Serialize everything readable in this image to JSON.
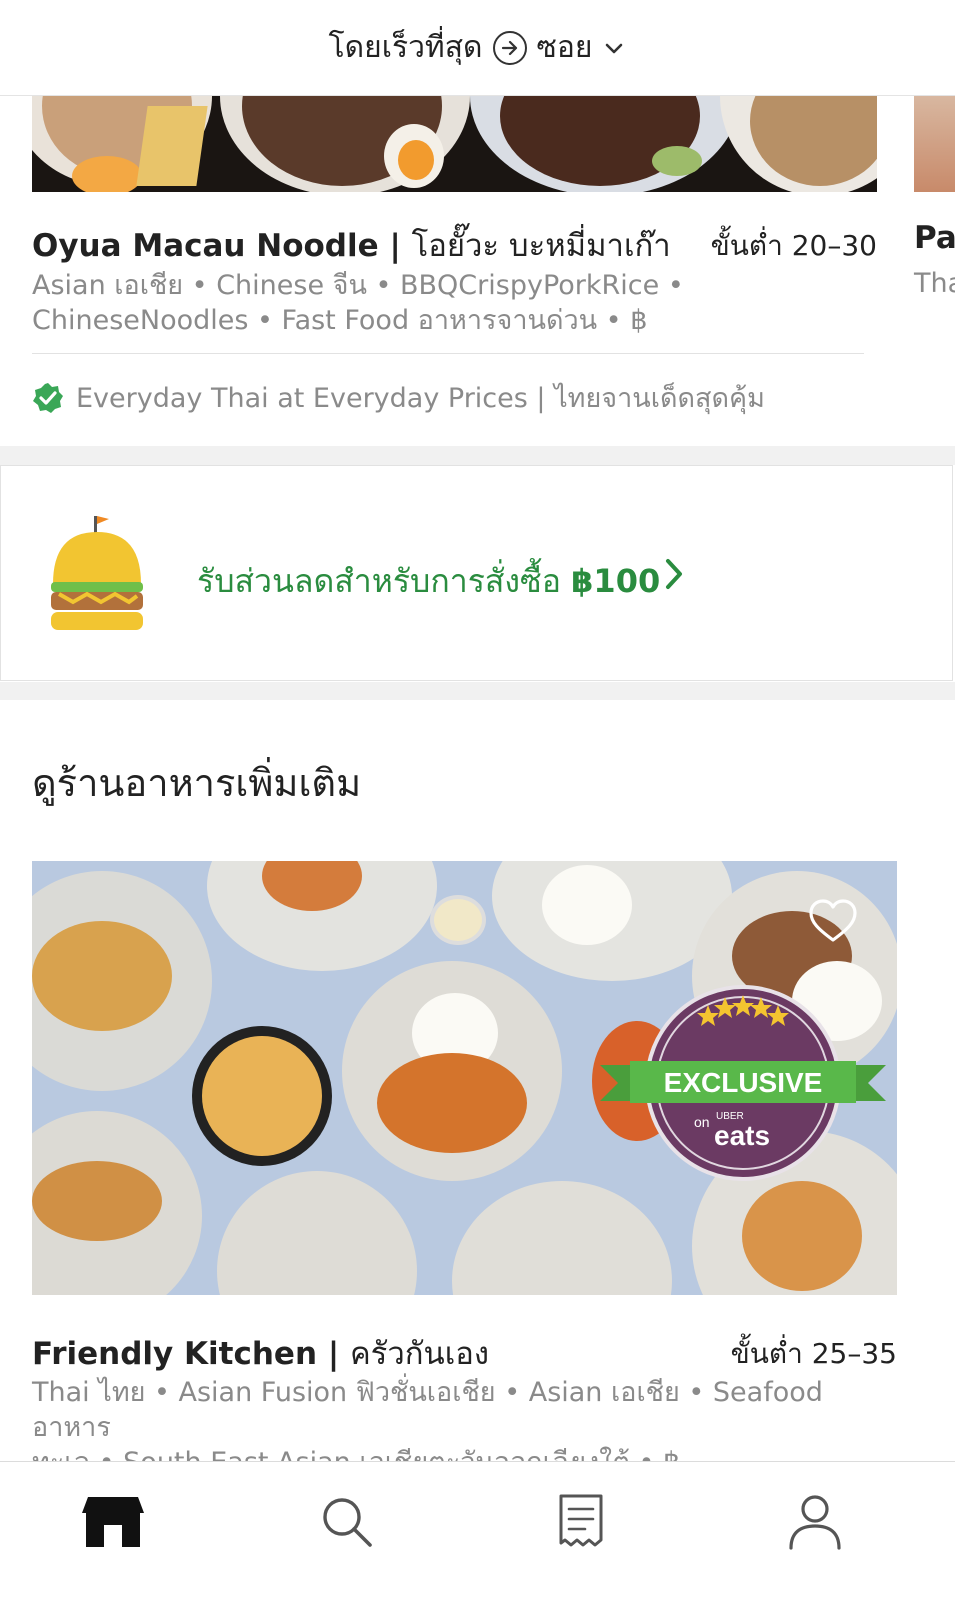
{
  "header": {
    "sort_label": "โดยเร็วที่สุด",
    "location": "ซอย"
  },
  "featured": {
    "name": "Oyua Macau Noodle |",
    "name_thai": "โอยั๊วะ บะหมี่มาเก๊า",
    "eta": "ขั้นต่ำ 20–30",
    "tags_line1": "Asian เอเชีย • Chinese จีน • BBQCrispyPorkRice •",
    "tags_line2": "ChineseNoodles • Fast Food อาหารจานด่วน • ฿",
    "promo": "Everyday Thai at Everyday Prices | ไทยจานเด็ดสุดคุ้ม"
  },
  "next_card": {
    "name": "Pa",
    "tag": "Tha"
  },
  "banner": {
    "text": "รับส่วนลดสำหรับการสั่งซื้อ",
    "amount": "฿100"
  },
  "more": {
    "title": "ดูร้านอาหารเพิ่มเติม",
    "restaurant": {
      "name": "Friendly Kitchen |",
      "name_thai": "ครัวกันเอง",
      "eta": "ขั้นต่ำ 25–35",
      "tags_line1": "Thai ไทย • Asian Fusion ฟิวชั่นเอเชีย • Asian เอเชีย • Seafood อาหาร",
      "tags_line2": "ทะเล • South East Asian เอเชียตะวันออกเฉียงใต้ • ฿",
      "badge_title": "EXCLUSIVE",
      "badge_on": "on",
      "badge_brand": "UBER",
      "badge_sub": "eats"
    }
  },
  "nav": {
    "items": [
      "home-icon",
      "search-icon",
      "orders-icon",
      "account-icon"
    ]
  },
  "colors": {
    "accent_green": "#2a8c3f",
    "badge_purple": "#6b3a63",
    "badge_green": "#59b84a"
  }
}
